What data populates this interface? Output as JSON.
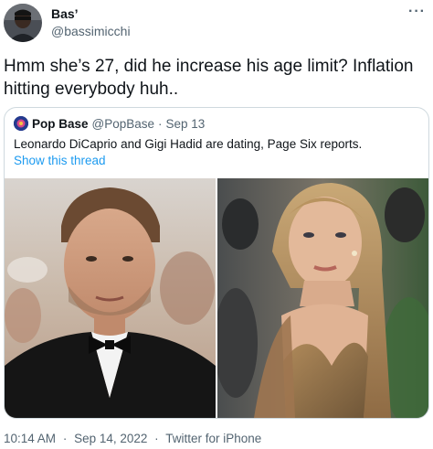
{
  "author": {
    "display_name": "Bas’",
    "handle": "@bassimicchi",
    "more_icon": "more-horizontal-icon"
  },
  "tweet": {
    "text": "Hmm she’s 27, did he increase his age limit? Inflation hitting everybody huh.."
  },
  "quoted_tweet": {
    "name": "Pop Base",
    "handle": "@PopBase",
    "separator": "·",
    "date": "Sep 13",
    "text": "Leonardo DiCaprio and Gigi Hadid are dating, Page Six reports.",
    "show_thread": "Show this thread"
  },
  "meta": {
    "time": "10:14 AM",
    "separator": "·",
    "date": "Sep 14, 2022",
    "source": "Twitter for iPhone"
  },
  "colors": {
    "link": "#1d9bf0",
    "secondary_text": "#536471",
    "border": "#cfd9de"
  }
}
